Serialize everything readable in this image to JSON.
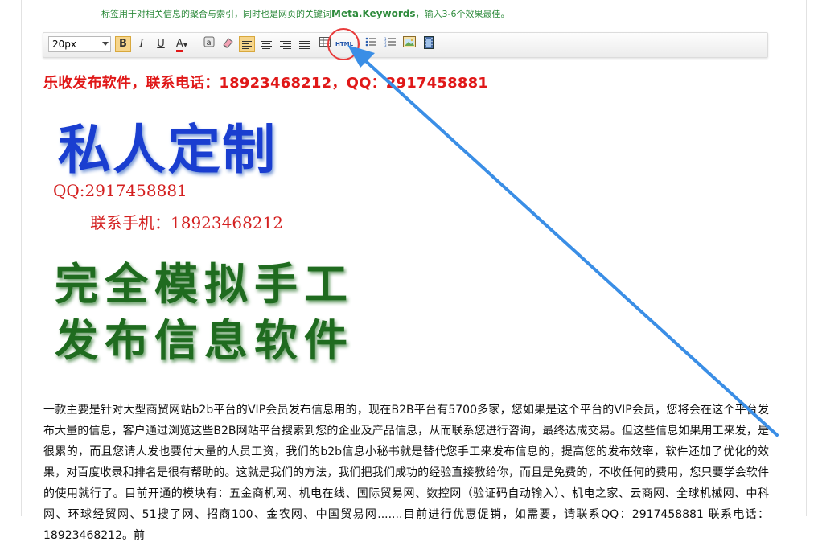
{
  "hint": {
    "text_before": "标签用于对相关信息的聚合与索引，同时也是网页的关键词",
    "keyword": "Meta.Keywords",
    "text_after": "，输入3-6个效果最佳。"
  },
  "toolbar": {
    "font_size_value": "20px",
    "bold_label": "B",
    "italic_label": "I",
    "underline_label": "U",
    "font_color_label": "A",
    "html_label": "HTML",
    "icons": [
      "bold-icon",
      "italic-icon",
      "underline-icon",
      "font-color-icon",
      "special-char-icon",
      "eraser-icon",
      "align-left-icon",
      "align-center-icon",
      "align-right-icon",
      "justify-icon",
      "table-icon",
      "html-source-icon",
      "bullet-list-icon",
      "numbered-list-icon",
      "image-icon",
      "media-icon"
    ]
  },
  "content": {
    "heading": "乐收发布软件，联系电话：18923468212，QQ：2917458881",
    "promo": {
      "title": "私人定制",
      "qq": "QQ:2917458881",
      "phone": "联系手机：18923468212",
      "line1": "完全模拟手工",
      "line2": "发布信息软件"
    },
    "paragraph": "一款主要是针对大型商贸网站b2b平台的VIP会员发布信息用的，现在B2B平台有5700多家，您如果是这个平台的VIP会员，您将会在这个平台发布大量的信息，客户通过浏览这些B2B网站平台搜索到您的企业及产品信息，从而联系您进行咨询，最终达成交易。但这些信息如果用工来发，是很累的，而且您请人发也要付大量的人员工资，我们的b2b信息小秘书就是替代您手工来发布信息的，提高您的发布效率，软件还加了优化的效果，对百度收录和排名是很有帮助的。这就是我们的方法，我们把我们成功的经验直接教给你，而且是免费的，不收任何的费用，您只要学会软件的使用就行了。目前开通的模块有：五金商机网、机电在线、国际贸易网、数控网（验证码自动输入）、机电之家、云商网、全球机械网、中科网、环球经贸网、51搜了网、招商100、金农网、中国贸易网.......目前进行优惠促销，如需要，请联系QQ：2917458881 联系电话：18923468212。前"
  },
  "colors": {
    "accent_red": "#e01818",
    "annotation_blue": "#3a8ee6",
    "promo_blue": "#1a3ed0",
    "promo_green": "#1f6b1f",
    "hint_green": "#2e8b3c"
  }
}
